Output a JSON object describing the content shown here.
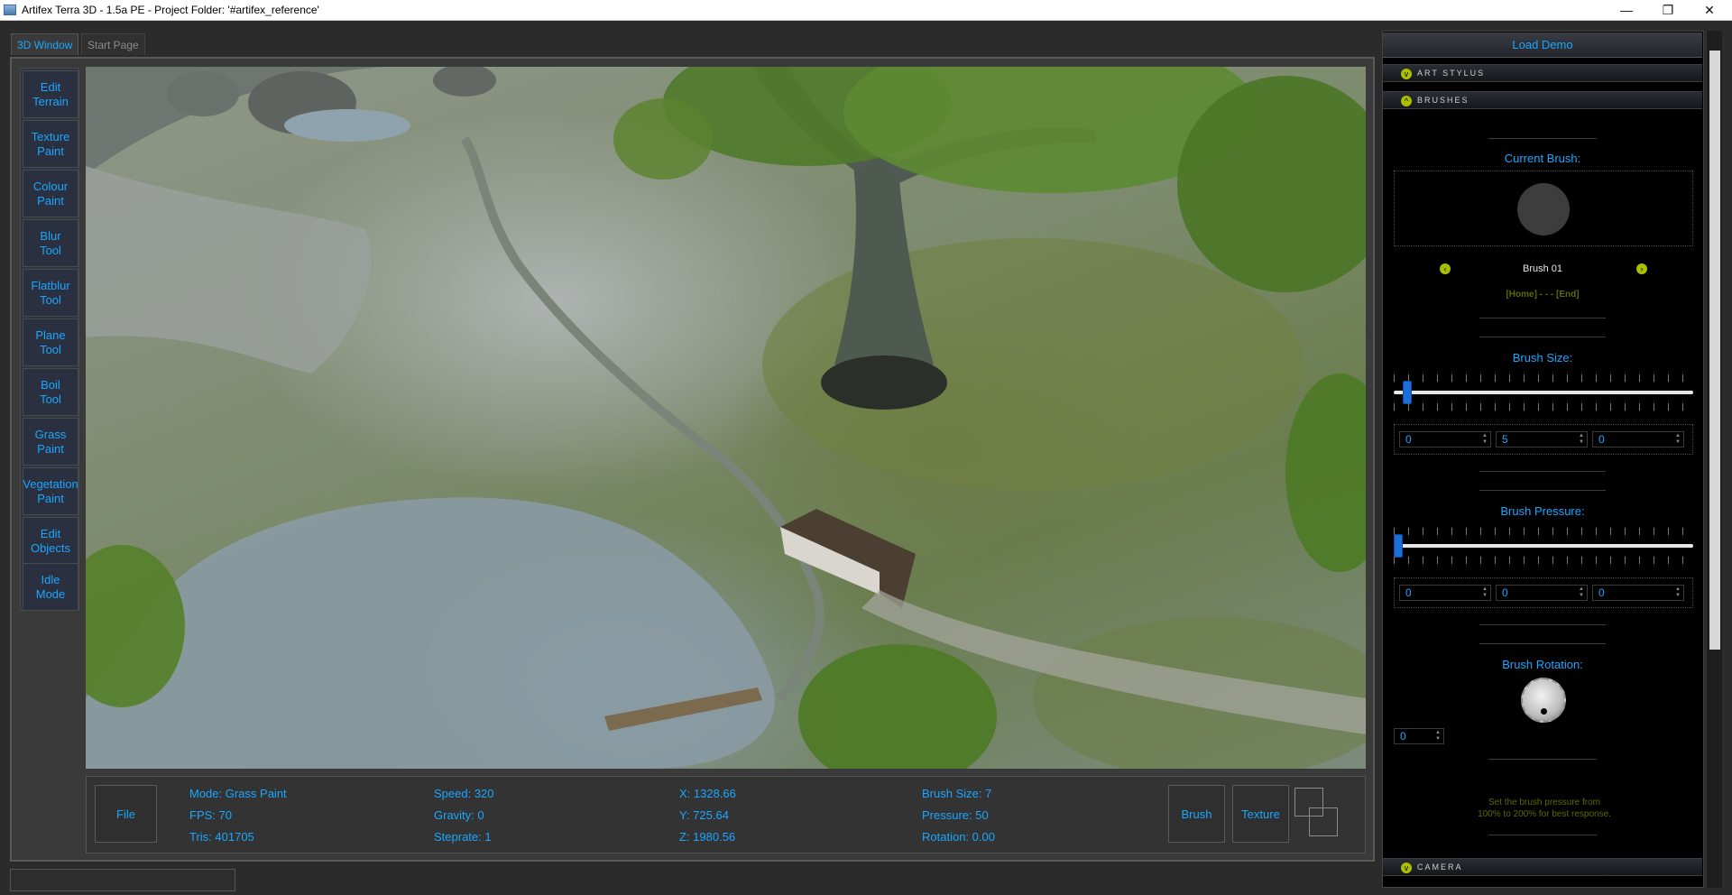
{
  "window": {
    "title": "Artifex Terra 3D - 1.5a PE - Project Folder: '#artifex_reference'",
    "controls": {
      "minimize": "—",
      "restore": "❐",
      "close": "✕"
    }
  },
  "tabs": [
    {
      "label": "3D Window",
      "active": true
    },
    {
      "label": "Start Page",
      "active": false
    }
  ],
  "tools": [
    "Edit\nTerrain",
    "Texture\nPaint",
    "Colour\nPaint",
    "Blur\nTool",
    "Flatblur\nTool",
    "Plane\nTool",
    "Boil\nTool",
    "Grass\nPaint",
    "Vegetation\nPaint",
    "Edit\nObjects",
    "Idle\nMode"
  ],
  "status": {
    "file_button": "File",
    "mode": "Mode: Grass Paint",
    "fps": "FPS: 70",
    "tris": "Tris: 401705",
    "speed": "Speed: 320",
    "gravity": "Gravity: 0",
    "steprate": "Steprate: 1",
    "x": "X: 1328.66",
    "y": "Y: 725.64",
    "z": "Z: 1980.56",
    "brush_size": "Brush Size: 7",
    "pressure": "Pressure: 50",
    "rotation": "Rotation: 0.00",
    "brush_button": "Brush",
    "texture_button": "Texture"
  },
  "panel": {
    "load_demo": "Load Demo",
    "sections": {
      "art_stylus": "ART STYLUS",
      "brushes": "BRUSHES",
      "camera": "CAMERA"
    },
    "current_brush_label": "Current Brush:",
    "brush_name": "Brush 01",
    "home_end": "[Home] - - - [End]",
    "brush_size_label": "Brush Size:",
    "brush_size_slider": 0.03,
    "brush_size_values": [
      "0",
      "5",
      "0"
    ],
    "brush_pressure_label": "Brush Pressure:",
    "brush_pressure_slider": 0.0,
    "brush_pressure_values": [
      "0",
      "0",
      "0"
    ],
    "brush_rotation_label": "Brush Rotation:",
    "brush_rotation_value": "0",
    "hint": "Set the brush pressure from\n100% to 200% for best response."
  },
  "colors": {
    "accent": "#1aa7ff",
    "lime": "#a8c000",
    "panel_bg": "#000000"
  }
}
